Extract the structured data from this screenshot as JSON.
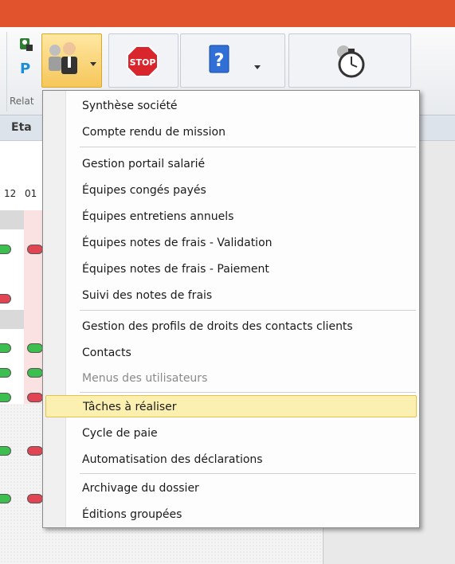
{
  "ribbon": {
    "group_label": "Relat"
  },
  "tab_header": {
    "title": "Eta"
  },
  "grid": {
    "col_a": "12",
    "col_b": "01"
  },
  "menu": {
    "items": [
      {
        "label": "Synthèse société"
      },
      {
        "label": "Compte rendu de mission"
      },
      {
        "label": "Gestion portail salarié"
      },
      {
        "label": "Équipes congés payés"
      },
      {
        "label": "Équipes entretiens annuels"
      },
      {
        "label": "Équipes notes de frais - Validation"
      },
      {
        "label": "Équipes notes de frais - Paiement"
      },
      {
        "label": "Suivi des notes de frais"
      },
      {
        "label": "Gestion des profils de droits des contacts clients"
      },
      {
        "label": "Contacts"
      },
      {
        "label": "Menus des utilisateurs",
        "disabled": true
      },
      {
        "label": "Tâches à réaliser",
        "highlighted": true
      },
      {
        "label": "Cycle de paie"
      },
      {
        "label": "Automatisation des déclarations"
      },
      {
        "label": "Archivage du dossier"
      },
      {
        "label": "Éditions groupées"
      }
    ]
  },
  "icons": [
    "user-admin-icon",
    "parking-icon",
    "users-group-icon",
    "stop-sign-icon",
    "help-book-icon",
    "timer-icon"
  ]
}
